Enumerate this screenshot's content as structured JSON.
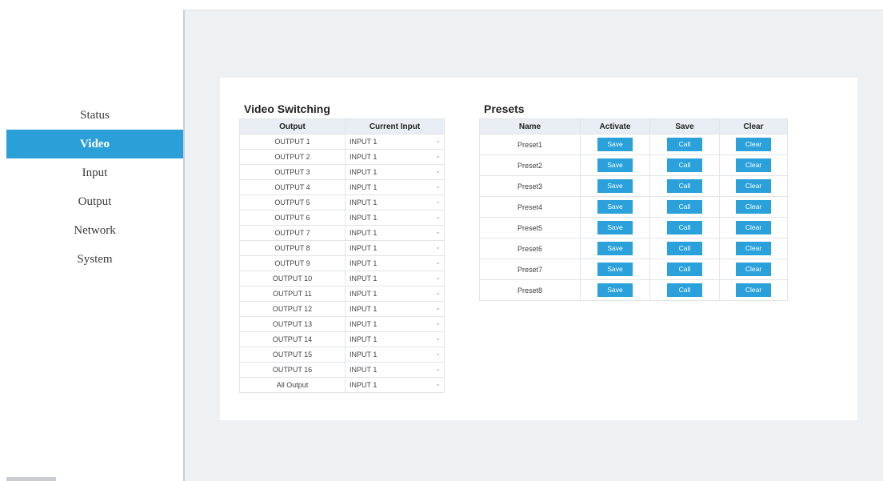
{
  "sidebar": {
    "items": [
      {
        "label": "Status"
      },
      {
        "label": "Video"
      },
      {
        "label": "Input"
      },
      {
        "label": "Output"
      },
      {
        "label": "Network"
      },
      {
        "label": "System"
      }
    ],
    "active": "Video"
  },
  "video_switching": {
    "title": "Video Switching",
    "headers": {
      "output": "Output",
      "current_input": "Current Input"
    },
    "rows": [
      {
        "output": "OUTPUT 1",
        "input": "INPUT 1"
      },
      {
        "output": "OUTPUT 2",
        "input": "INPUT 1"
      },
      {
        "output": "OUTPUT 3",
        "input": "INPUT 1"
      },
      {
        "output": "OUTPUT 4",
        "input": "INPUT 1"
      },
      {
        "output": "OUTPUT 5",
        "input": "INPUT 1"
      },
      {
        "output": "OUTPUT 6",
        "input": "INPUT 1"
      },
      {
        "output": "OUTPUT 7",
        "input": "INPUT 1"
      },
      {
        "output": "OUTPUT 8",
        "input": "INPUT 1"
      },
      {
        "output": "OUTPUT 9",
        "input": "INPUT 1"
      },
      {
        "output": "OUTPUT 10",
        "input": "INPUT 1"
      },
      {
        "output": "OUTPUT 11",
        "input": "INPUT 1"
      },
      {
        "output": "OUTPUT 12",
        "input": "INPUT 1"
      },
      {
        "output": "OUTPUT 13",
        "input": "INPUT 1"
      },
      {
        "output": "OUTPUT 14",
        "input": "INPUT 1"
      },
      {
        "output": "OUTPUT 15",
        "input": "INPUT 1"
      },
      {
        "output": "OUTPUT 16",
        "input": "INPUT 1"
      },
      {
        "output": "All Output",
        "input": "INPUT 1"
      }
    ]
  },
  "presets": {
    "title": "Presets",
    "headers": {
      "name": "Name",
      "activate": "Activate",
      "save": "Save",
      "clear": "Clear"
    },
    "button_labels": {
      "activate": "Save",
      "save": "Call",
      "clear": "Clear"
    },
    "rows": [
      {
        "name": "Preset1"
      },
      {
        "name": "Preset2"
      },
      {
        "name": "Preset3"
      },
      {
        "name": "Preset4"
      },
      {
        "name": "Preset5"
      },
      {
        "name": "Preset6"
      },
      {
        "name": "Preset7"
      },
      {
        "name": "Preset8"
      }
    ]
  },
  "colors": {
    "accent": "#2a9fd8",
    "button": "#2aa1da",
    "background": "#eef1f4",
    "table_header": "#e8eef3"
  }
}
